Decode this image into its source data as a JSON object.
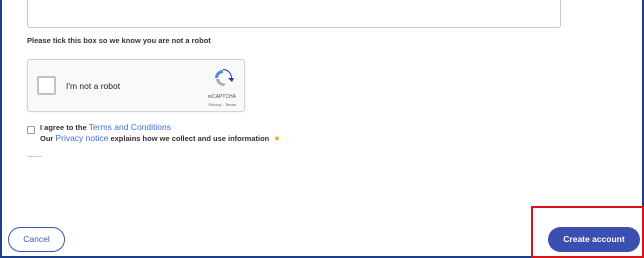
{
  "form": {
    "robot_prompt": "Please tick this box so we know you are not a robot",
    "recaptcha": {
      "label": "I'm not a robot",
      "brand": "reCAPTCHA",
      "links": "Privacy - Terms"
    },
    "terms": {
      "agree_prefix": "I agree to the",
      "terms_link": "Terms and Conditions",
      "privacy_prefix": "Our",
      "privacy_link": "Privacy notice",
      "privacy_suffix": "explains how we collect and use information",
      "required_marker": "★"
    }
  },
  "actions": {
    "cancel_label": "Cancel",
    "create_label": "Create account"
  },
  "colors": {
    "primary": "#3b4fb0",
    "link": "#3f6fd8",
    "highlight": "#d9151b",
    "frame": "#1d3f8a",
    "required": "#f39c12"
  }
}
